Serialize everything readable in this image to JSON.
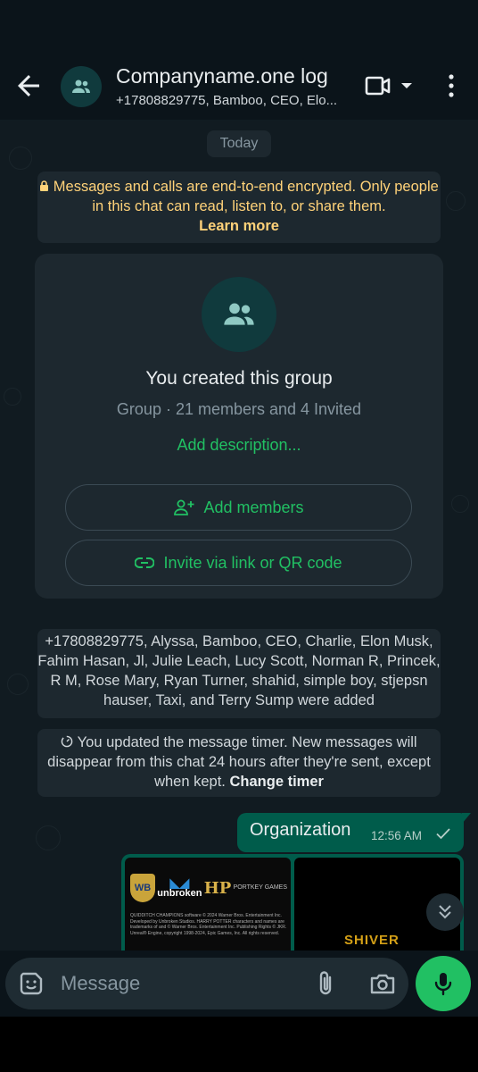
{
  "header": {
    "title": "Companyname.one log",
    "subtitle": "+17808829775, Bamboo, CEO, Elo..."
  },
  "chat": {
    "date_chip": "Today",
    "encryption_notice": "Messages and calls are end-to-end encrypted. Only people in this chat can read, listen to, or share them.",
    "encryption_link": "Learn more",
    "group_card": {
      "title": "You created this group",
      "meta": "Group · 21 members and 4 Invited",
      "add_description": "Add description...",
      "add_members_label": "Add members",
      "invite_label": "Invite via link or QR code"
    },
    "members_added": "+17808829775, Alyssa, Bamboo, CEO, Charlie, Elon Musk, Fahim Hasan, Jl, Julie Leach, Lucy Scott, Norman R, Princek, R M, Rose Mary, Ryan Turner, shahid, simple boy, stjepsn hauser, Taxi, and Terry Sump were added",
    "timer_notice": "You updated the message timer. New messages will disappear from this chat 24 hours after they're sent, except when kept.",
    "timer_link": "Change timer",
    "outgoing_message": {
      "text": "Organization",
      "time": "12:56 AM"
    },
    "image_message": {
      "logo_unbroken": "unbroken",
      "logo_hp": "HP",
      "logo_portkey": "PORTKEY GAMES",
      "fine_print": "QUIDDITCH CHAMPIONS software © 2024 Warner Bros. Entertainment Inc. Developed by Unbroken Studios. HARRY POTTER characters and names are trademarks of and © Warner Bros. Entertainment Inc. Publishing Rights © JKR. Unreal® Engine, copyright 1998-2024, Epic Games, Inc. All rights reserved.",
      "shiver": "SHIVER"
    }
  },
  "composer": {
    "placeholder": "Message"
  },
  "colors": {
    "accent": "#21c063",
    "outgoing_bubble": "#005c4b",
    "background": "#0b141a",
    "system_bubble": "#1d282f",
    "encryption_text": "#ffd279"
  },
  "icons": {
    "back": "arrow-left-icon",
    "group_avatar": "group-icon",
    "video": "video-camera-icon",
    "dropdown": "caret-down-icon",
    "more": "more-vertical-icon",
    "lock": "lock-icon",
    "add_person": "add-person-icon",
    "link": "link-icon",
    "timer": "timer-icon",
    "read_tick": "check-icon",
    "scroll_down": "double-chevron-down-icon",
    "sticker": "sticker-icon",
    "attach": "paperclip-icon",
    "camera": "camera-icon",
    "mic": "mic-icon"
  }
}
